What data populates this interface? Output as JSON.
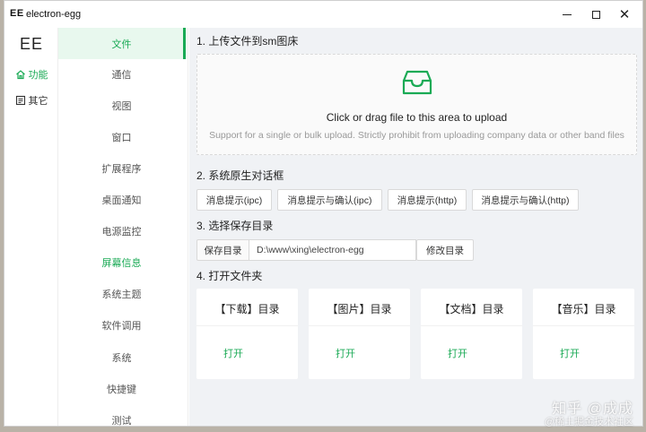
{
  "window": {
    "logo": "EE",
    "title": "electron-egg",
    "minimize_symbol": "",
    "close_symbol": "✕"
  },
  "rail": {
    "logo": "EE",
    "items": [
      {
        "label": "功能",
        "icon": "home-icon",
        "active": true
      },
      {
        "label": "其它",
        "icon": "list-icon",
        "active": false
      }
    ]
  },
  "submenu": {
    "items": [
      {
        "label": "文件"
      },
      {
        "label": "通信"
      },
      {
        "label": "视图"
      },
      {
        "label": "窗口"
      },
      {
        "label": "扩展程序"
      },
      {
        "label": "桌面通知"
      },
      {
        "label": "电源监控"
      },
      {
        "label": "屏幕信息"
      },
      {
        "label": "系统主题"
      },
      {
        "label": "软件调用"
      },
      {
        "label": "系统"
      },
      {
        "label": "快捷键"
      },
      {
        "label": "测试"
      }
    ]
  },
  "sections": {
    "upload_title": "1. 上传文件到sm图床",
    "dialog_title": "2. 系统原生对话框",
    "save_dir_title": "3. 选择保存目录",
    "open_folder_title": "4. 打开文件夹"
  },
  "upload": {
    "text": "Click or drag file to this area to upload",
    "hint": "Support for a single or bulk upload. Strictly prohibit from uploading company data or other band files"
  },
  "dialog_buttons": [
    "消息提示(ipc)",
    "消息提示与确认(ipc)",
    "消息提示(http)",
    "消息提示与确认(http)"
  ],
  "save_dir": {
    "label": "保存目录",
    "value": "D:\\www\\xing\\electron-egg",
    "change_button": "修改目录"
  },
  "folders": [
    {
      "title": "【下载】目录",
      "action": "打开"
    },
    {
      "title": "【图片】目录",
      "action": "打开"
    },
    {
      "title": "【文档】目录",
      "action": "打开"
    },
    {
      "title": "【音乐】目录",
      "action": "打开"
    }
  ],
  "watermark": {
    "main": "知乎 @成成",
    "sub": "@稀土掘金技术社区"
  },
  "colors": {
    "accent": "#1aaa55",
    "active_bg": "#e8f8ee",
    "main_bg": "#f0f2f5"
  }
}
